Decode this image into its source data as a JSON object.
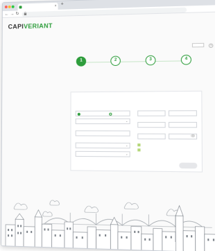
{
  "browser": {
    "tab_title": "",
    "tab_close": "×",
    "new_tab": "+",
    "url": "",
    "back": "←",
    "forward": "→",
    "reload": "↻",
    "lock": "🔒"
  },
  "header": {
    "logo_a": "CAPI",
    "logo_b": "VERIANT",
    "top_right_text": "",
    "language_value": "",
    "help": "?"
  },
  "intro_text": "",
  "steps": [
    {
      "number": "1",
      "label": "",
      "active": true
    },
    {
      "number": "2",
      "label": "",
      "active": false
    },
    {
      "number": "3",
      "label": "",
      "active": false
    },
    {
      "number": "4",
      "label": "",
      "active": false
    }
  ],
  "form": {
    "intro": "",
    "left_title": "",
    "right_title": "",
    "organization_type_label": "",
    "radio_1": "",
    "radio_2": "",
    "select_placeholder": "",
    "organization_name_label": "",
    "country_label": "",
    "country_value": "",
    "state_value": "",
    "first_name_label": "",
    "last_name_label": "",
    "phone_label": "",
    "mobile_label": "",
    "email_label": "",
    "password_label": "",
    "terms_pre": "",
    "terms_link": "",
    "privacy_pre": "",
    "privacy_link": "",
    "submit_label": ""
  },
  "footer": {
    "link_1": "",
    "link_2": "",
    "link_3": "",
    "logo": ""
  },
  "colors": {
    "accent": "#2e9d3c",
    "accent_light": "#b5d77a"
  },
  "icons": {
    "chevron": "chevron-down-icon",
    "eye": "eye-icon"
  }
}
